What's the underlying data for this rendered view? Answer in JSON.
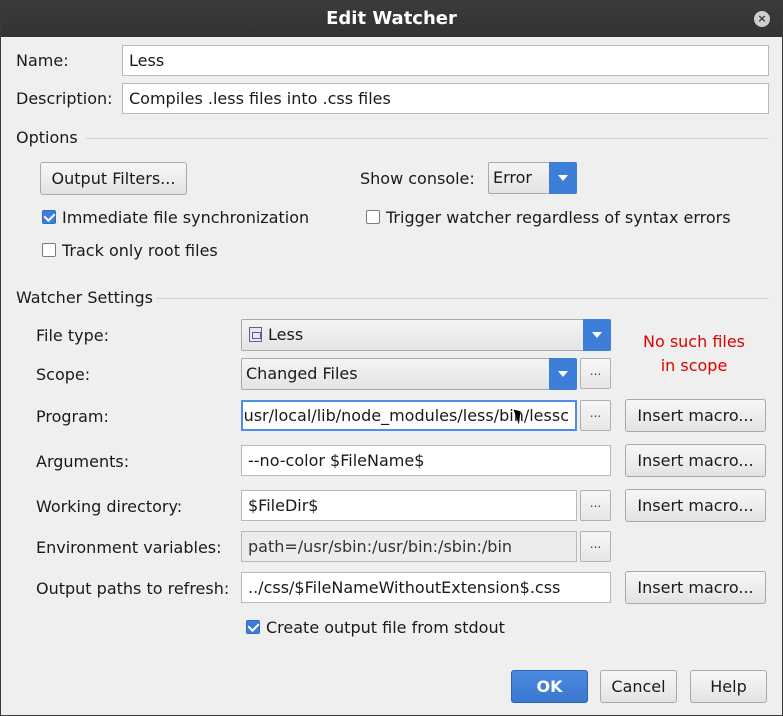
{
  "window": {
    "title": "Edit Watcher"
  },
  "name": {
    "label": "Name:",
    "value": "Less"
  },
  "description": {
    "label": "Description:",
    "value": "Compiles .less files into .css files"
  },
  "options": {
    "heading": "Options",
    "output_filters_label": "Output Filters...",
    "show_console_label": "Show console:",
    "show_console_value": "Error",
    "immediate_sync": {
      "label": "Immediate file synchronization",
      "checked": true
    },
    "trigger_regardless": {
      "label": "Trigger watcher regardless of syntax errors",
      "checked": false
    },
    "track_root": {
      "label": "Track only root files",
      "checked": false
    }
  },
  "watcher_settings": {
    "heading": "Watcher Settings",
    "file_type": {
      "label": "File type:",
      "value": "Less"
    },
    "scope": {
      "label": "Scope:",
      "value": "Changed Files"
    },
    "scope_warning_line1": "No such files",
    "scope_warning_line2": "in scope",
    "program": {
      "label": "Program:",
      "value": "usr/local/lib/node_modules/less/bin/lessc"
    },
    "arguments": {
      "label": "Arguments:",
      "value": "--no-color $FileName$"
    },
    "working_directory": {
      "label": "Working directory:",
      "value": "$FileDir$"
    },
    "environment_variables": {
      "label": "Environment variables:",
      "value": "path=/usr/sbin:/usr/bin:/sbin:/bin"
    },
    "output_paths": {
      "label": "Output paths to refresh:",
      "value": "../css/$FileNameWithoutExtension$.css"
    },
    "create_output": {
      "label": "Create output file from stdout",
      "checked": true
    },
    "insert_macro_label": "Insert macro...",
    "browse_label": "..."
  },
  "footer": {
    "ok": "OK",
    "cancel": "Cancel",
    "help": "Help"
  },
  "colors": {
    "accent": "#3d7fd8",
    "warning": "#e00000"
  }
}
